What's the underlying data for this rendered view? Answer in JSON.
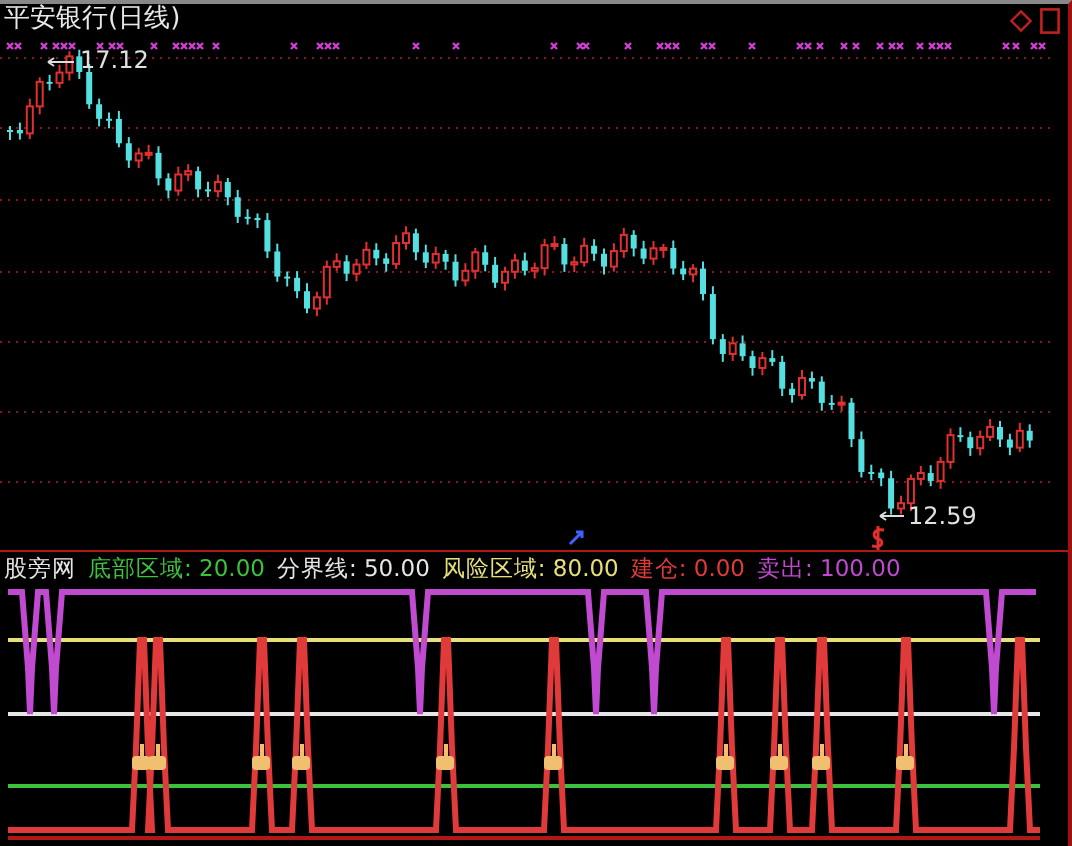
{
  "window": {
    "title": "平安银行(日线)"
  },
  "price_labels": [
    {
      "kind": "high",
      "text": "17.12"
    },
    {
      "kind": "low",
      "text": "12.59"
    }
  ],
  "indicator": {
    "name": "股旁网",
    "legend": [
      {
        "text": "底部区域: 20.00",
        "color": "#3cc23c"
      },
      {
        "text": "分界线: 50.00",
        "color": "#e6e6e6"
      },
      {
        "text": "风险区域: 80.00",
        "color": "#e6e07a"
      },
      {
        "text": "建仓: 0.00",
        "color": "#e03a3a"
      },
      {
        "text": "卖出: 100.00",
        "color": "#c04ad0"
      }
    ]
  }
}
